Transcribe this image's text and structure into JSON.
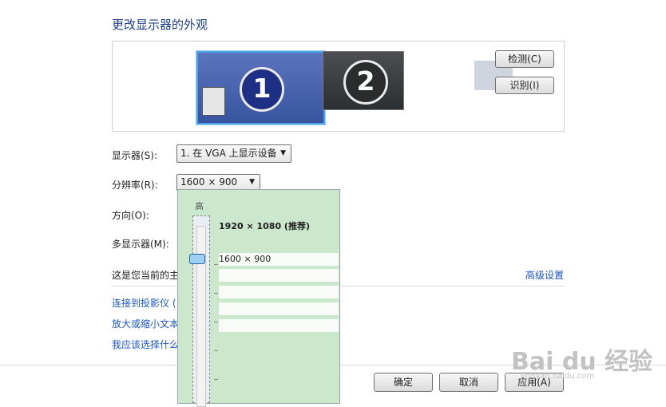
{
  "title": "更改显示器的外观",
  "monitors": [
    {
      "number": "1"
    },
    {
      "number": "2"
    }
  ],
  "buttons": {
    "detect": "检测(C)",
    "identify": "识别(I)"
  },
  "display": {
    "label": "显示器(S):",
    "value": "1. 在 VGA 上显示设备"
  },
  "resolution": {
    "label": "分辨率(R):",
    "value": "1600 × 900"
  },
  "orientation": {
    "label": "方向(O):"
  },
  "multi_display": {
    "label": "多显示器(M):"
  },
  "current_text": "这是您当前的主",
  "advanced_link": "高级设置",
  "links": [
    "连接到投影仪 (",
    "放大或缩小文本",
    "我应该选择什么"
  ],
  "popup": {
    "high_label": "高",
    "options": [
      "1920 × 1080 (推荐)",
      "1600 × 900",
      "",
      "",
      "",
      ""
    ],
    "selected_level": 0.25
  },
  "footer": {
    "ok": "确定",
    "cancel": "取消",
    "apply": "应用(A)"
  },
  "watermark": {
    "brand": "Bai du 经验",
    "url": "jingyan.baidu.com"
  }
}
